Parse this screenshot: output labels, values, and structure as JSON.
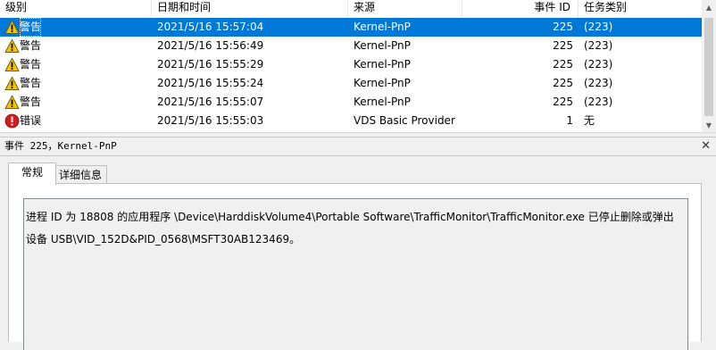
{
  "columns": {
    "level": "级别",
    "datetime": "日期和时间",
    "source": "来源",
    "event_id": "事件 ID",
    "task": "任务类别"
  },
  "events": [
    {
      "level": "警告",
      "icon": "warning-icon",
      "datetime": "2021/5/16 15:57:04",
      "source": "Kernel-PnP",
      "event_id": "225",
      "task": "(223)",
      "selected": true
    },
    {
      "level": "警告",
      "icon": "warning-icon",
      "datetime": "2021/5/16 15:56:49",
      "source": "Kernel-PnP",
      "event_id": "225",
      "task": "(223)"
    },
    {
      "level": "警告",
      "icon": "warning-icon",
      "datetime": "2021/5/16 15:55:29",
      "source": "Kernel-PnP",
      "event_id": "225",
      "task": "(223)"
    },
    {
      "level": "警告",
      "icon": "warning-icon",
      "datetime": "2021/5/16 15:55:24",
      "source": "Kernel-PnP",
      "event_id": "225",
      "task": "(223)"
    },
    {
      "level": "警告",
      "icon": "warning-icon",
      "datetime": "2021/5/16 15:55:07",
      "source": "Kernel-PnP",
      "event_id": "225",
      "task": "(223)"
    },
    {
      "level": "错误",
      "icon": "error-icon",
      "datetime": "2021/5/16 15:55:03",
      "source": "VDS Basic Provider",
      "event_id": "1",
      "task": "无"
    }
  ],
  "detail": {
    "title": "事件 225，Kernel-PnP",
    "close_glyph": "✕",
    "tabs": {
      "general": "常规",
      "details": "详细信息"
    },
    "description_line1": "进程 ID 为 18808 的应用程序 \\Device\\HarddiskVolume4\\Portable Software\\TrafficMonitor\\TrafficMonitor.exe 已停止删除或弹出",
    "description_line2": "设备 USB\\VID_152D&PID_0568\\MSFT30AB123469。"
  },
  "colors": {
    "selection": "#0078d7",
    "warning": "#f5c400",
    "error": "#d41c1c"
  }
}
